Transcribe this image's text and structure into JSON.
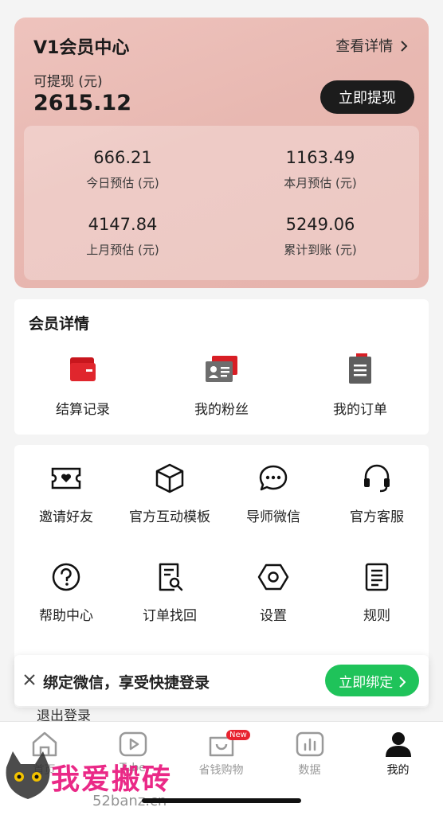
{
  "vip": {
    "title": "V1会员中心",
    "detail_link": "查看详情",
    "withdrawable_label": "可提现 (元)",
    "balance": "2615.12",
    "withdraw_button": "立即提现",
    "stats": [
      {
        "value": "666.21",
        "label": "今日预估 (元)"
      },
      {
        "value": "1163.49",
        "label": "本月预估 (元)"
      },
      {
        "value": "4147.84",
        "label": "上月预估 (元)"
      },
      {
        "value": "5249.06",
        "label": "累计到账 (元)"
      }
    ]
  },
  "member": {
    "title": "会员详情",
    "items": [
      {
        "label": "结算记录",
        "icon": "wallet-icon"
      },
      {
        "label": "我的粉丝",
        "icon": "fans-card-icon"
      },
      {
        "label": "我的订单",
        "icon": "order-clipboard-icon"
      }
    ]
  },
  "tools": [
    {
      "label": "邀请好友",
      "icon": "ticket-heart-icon"
    },
    {
      "label": "官方互动模板",
      "icon": "cube-icon"
    },
    {
      "label": "导师微信",
      "icon": "chat-bubble-icon"
    },
    {
      "label": "官方客服",
      "icon": "headset-icon"
    },
    {
      "label": "帮助中心",
      "icon": "question-circle-icon"
    },
    {
      "label": "订单找回",
      "icon": "document-search-icon"
    },
    {
      "label": "设置",
      "icon": "hexagon-settings-icon"
    },
    {
      "label": "规则",
      "icon": "rules-list-icon"
    }
  ],
  "logout_label": "退出登录",
  "bind_banner": {
    "text": "绑定微信，享受快捷登录",
    "button": "立即绑定"
  },
  "tabbar": {
    "items": [
      {
        "label": "首页",
        "icon": "home-icon"
      },
      {
        "label": "Tube",
        "icon": "play-icon"
      },
      {
        "label": "省钱购物",
        "icon": "shopping-bag-icon",
        "badge": "New"
      },
      {
        "label": "数据",
        "icon": "bar-chart-icon"
      },
      {
        "label": "我的",
        "icon": "profile-icon"
      }
    ]
  },
  "watermark": {
    "title": "我爱搬砖",
    "url": "52banz.cn"
  },
  "colors": {
    "vip_card": "#e8b8b1",
    "withdraw_button": "#1c1c1c",
    "bind_button": "#1fc35a",
    "icon_red": "#d81e25",
    "badge_red": "#e8232f"
  }
}
